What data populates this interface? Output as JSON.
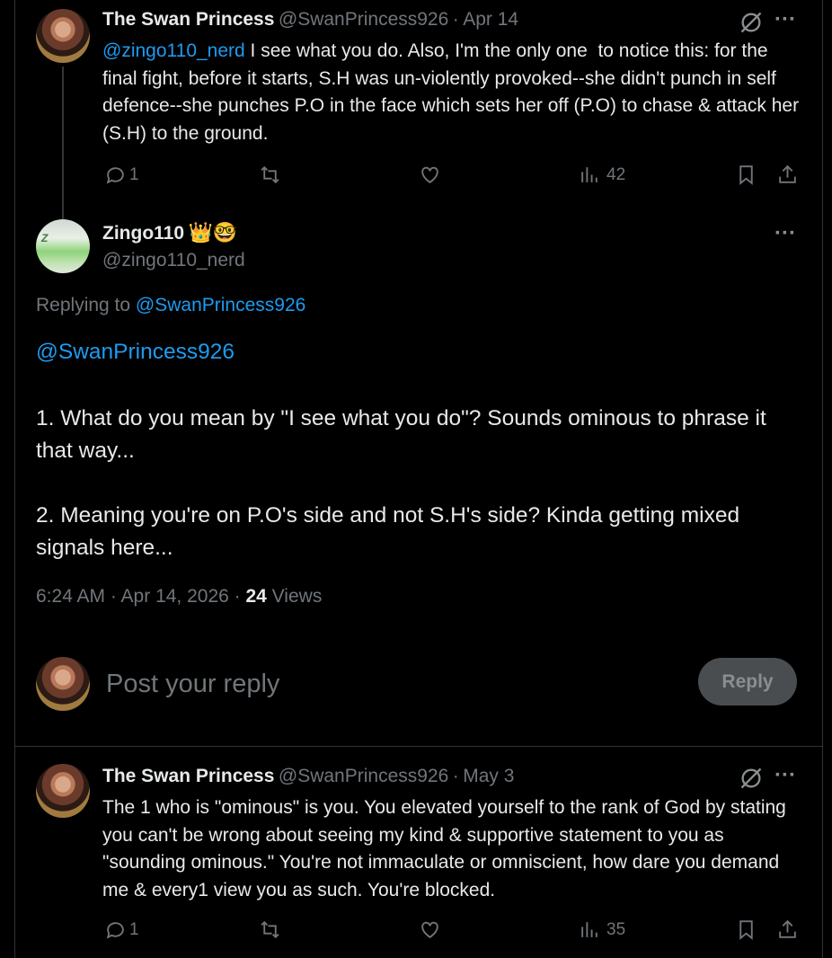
{
  "tweet1": {
    "author_name": "The Swan Princess",
    "handle": "@SwanPrincess926",
    "separator": "·",
    "date": "Apr 14",
    "mention": "@zingo110_nerd",
    "body": " I see what you do. Also, I'm the only one  to notice this: for the final fight, before it starts, S.H was un-violently provoked--she didn't punch in self defence--she punches P.O in the face which sets her off (P.O) to chase & attack her (S.H) to the ground.",
    "reply_count": "1",
    "view_count": "42"
  },
  "main_tweet": {
    "author_name": "Zingo110",
    "badges": "👑🤓",
    "handle": "@zingo110_nerd",
    "replying_prefix": "Replying to ",
    "replying_to": "@SwanPrincess926",
    "mention": "@SwanPrincess926",
    "paragraph1": "1. What do you mean by \"I see what you do\"?  Sounds ominous to phrase it that way...",
    "paragraph2": "2. Meaning you're on P.O's side and not S.H's side? Kinda getting mixed signals here...",
    "timestamp": "6:24 AM · Apr 14, 2026 · ",
    "views_count": "24",
    "views_label": " Views"
  },
  "composer": {
    "placeholder": "Post your reply",
    "reply_label": "Reply"
  },
  "tweet2": {
    "author_name": "The Swan Princess",
    "handle": "@SwanPrincess926",
    "separator": "·",
    "date": "May 3",
    "body": "The 1 who is \"ominous\" is you. You elevated yourself to the rank of God by stating you can't be wrong about seeing my kind & supportive statement to you as \"sounding ominous.\" You're not immaculate or omniscient, how dare you demand me & every1 view you as such. You're blocked.",
    "reply_count": "1",
    "view_count": "35"
  },
  "colors": {
    "background": "#000000",
    "text": "#e7e9ea",
    "muted": "#71767b",
    "link": "#1d9bf0",
    "border": "#2f3336"
  },
  "more_label": "···"
}
